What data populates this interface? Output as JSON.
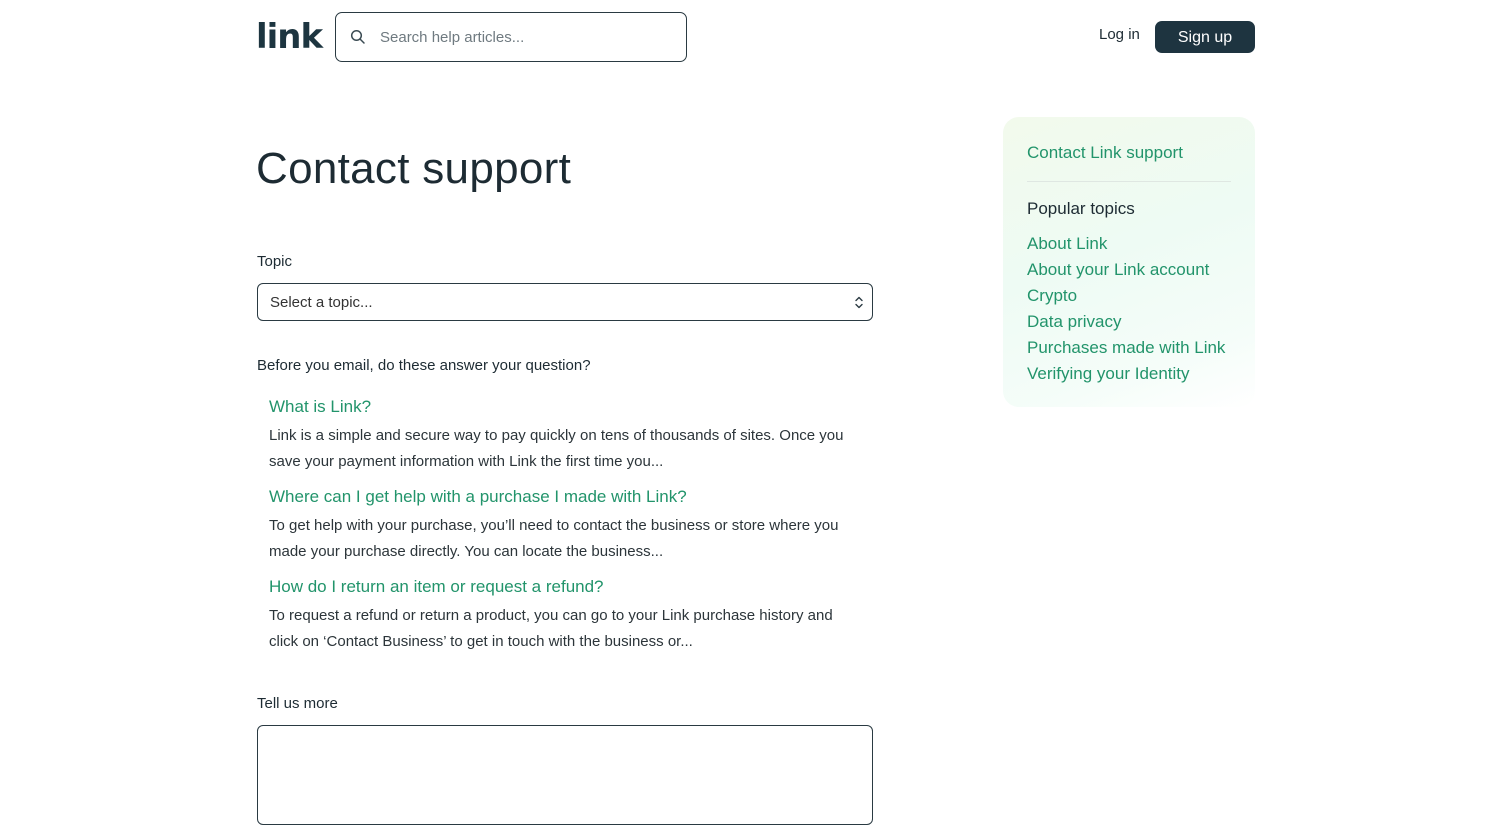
{
  "header": {
    "logo_text": "link",
    "search_placeholder": "Search help articles...",
    "login_label": "Log in",
    "signup_label": "Sign up"
  },
  "main": {
    "title": "Contact support",
    "topic_label": "Topic",
    "topic_select_value": "Select a topic...",
    "before_text": "Before you email, do these answer your question?",
    "articles": [
      {
        "title": "What is Link?",
        "excerpt": "Link is a simple and secure way to pay quickly on tens of thousands of sites. Once you save your payment information with Link the first time you..."
      },
      {
        "title": "Where can I get help with a purchase I made with Link?",
        "excerpt": "To get help with your purchase, you’ll need to contact the business or store where you made your purchase directly. You can locate the business..."
      },
      {
        "title": "How do I return an item or request a refund?",
        "excerpt": "To request a refund or return a product, you can go to your Link purchase history and click on ‘Contact Business’ to get in touch with the business or..."
      }
    ],
    "tell_us_more_label": "Tell us more"
  },
  "sidebar": {
    "contact_link": "Contact Link support",
    "popular_heading": "Popular topics",
    "topics": [
      "About Link",
      "About your Link account",
      "Crypto",
      "Data privacy",
      "Purchases made with Link",
      "Verifying your Identity"
    ]
  },
  "colors": {
    "accent_green": "#22946b",
    "dark_button": "#1e3440",
    "text_dark": "#1d2b33"
  }
}
